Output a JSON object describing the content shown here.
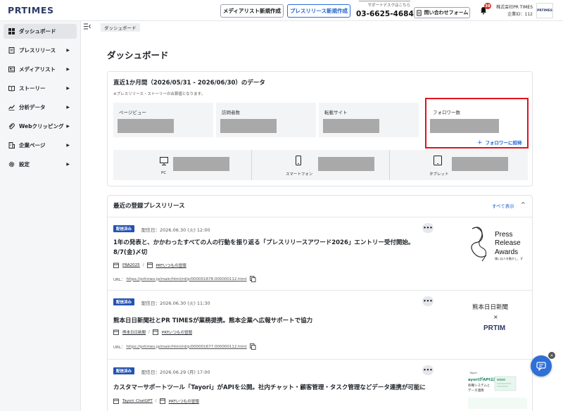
{
  "header": {
    "logo": "PRTIMES",
    "media_list_button": "メディアリスト新規作成",
    "press_release_button": "プレスリリース新規作成",
    "support_label": "サポートデスクはこちら",
    "phone": "03-6625-4684",
    "contact_button": "問い合わせフォーム",
    "notification_count": "38",
    "company_name": "株式会社PR TIMES",
    "company_id": "企業ID：112",
    "company_logo": "PRTIMES"
  },
  "sidebar": {
    "items": [
      {
        "label": "ダッシュボード",
        "icon": "dashboard-icon"
      },
      {
        "label": "プレスリリース",
        "icon": "document-icon",
        "chevron": "▶"
      },
      {
        "label": "メディアリスト",
        "icon": "newspaper-icon",
        "chevron": "▶"
      },
      {
        "label": "ストーリー",
        "icon": "book-icon",
        "chevron": "▶"
      },
      {
        "label": "分析データ",
        "icon": "chart-line-icon",
        "chevron": "▶"
      },
      {
        "label": "Webクリッピング",
        "icon": "paperclip-icon",
        "chevron": "▶"
      },
      {
        "label": "企業ページ",
        "icon": "building-icon",
        "chevron": "▶"
      },
      {
        "label": "設定",
        "icon": "gear-icon",
        "chevron": "▶"
      }
    ]
  },
  "breadcrumb": "ダッシュボード",
  "page_title": "ダッシュボード",
  "stats_card": {
    "title": "直近1か月間（2026/05/31 - 2026/06/30）のデータ",
    "note": "※プレスリリース・ストーリーの合算値となります。",
    "stats": [
      {
        "label": "ページビュー"
      },
      {
        "label": "訪問者数"
      },
      {
        "label": "転載サイト"
      },
      {
        "label": "フォロワー数"
      }
    ],
    "invite_plus": "+",
    "invite_label": "フォロワーに招待",
    "devices": [
      {
        "label": "PC",
        "icon": "monitor-icon"
      },
      {
        "label": "スマートフォン",
        "icon": "smartphone-icon"
      },
      {
        "label": "タブレット",
        "icon": "tablet-icon"
      }
    ]
  },
  "releases_card": {
    "title": "最近の登録プレスリリース",
    "see_all": "すべて表示",
    "caret": "^",
    "url_label": "URL：",
    "items": [
      {
        "status": "配信済み",
        "date": "配信日：2026.06.30 (火) 12:00",
        "more": "•••",
        "title": "1年の発表と、かかわったすべての人の行動を振り返る「プレスリリースアワード2026」エントリー受付開始。8/7(金)〆切",
        "tag1": "PRA2025",
        "sep": "/",
        "tag2": "PRTいつもの冒頭",
        "url": "https://prtimes.jp/main/html/rd/p/000001678.000000112.html",
        "thumb_text": [
          "Press",
          "Release",
          "Awards",
          "僕いは人を動かし、ず"
        ]
      },
      {
        "status": "配信済み",
        "date": "配信日：2026.06.30 (火) 11:30",
        "more": "•••",
        "title": "熊本日日新聞社とPR TIMESが業務提携。熊本企業へ広報サポートで協力",
        "tag1": "熊本日日新聞",
        "sep": "/",
        "tag2": "PRTいつもの冒頭",
        "url": "https://prtimes.jp/main/html/rd/p/000001677.000000112.html",
        "thumb_text": [
          "熊本日日新聞",
          "×",
          "PRTIM"
        ]
      },
      {
        "status": "配信済み",
        "date": "配信日：2026.06.29 (月) 17:00",
        "more": "•••",
        "title": "カスタマーサポートツール「Tayori」がAPIを公開。社内チャット・顧客管理・タスク管理などデータ連携が可能に",
        "tag1": "Tayori_ChatGPT",
        "sep": "/",
        "tag2": "PRTいつもの冒頭",
        "thumb_text": [
          "Tayori",
          "ayoriがAPI公開",
          "各種システムと",
          "データ連携"
        ]
      }
    ]
  },
  "chat_close": "×"
}
